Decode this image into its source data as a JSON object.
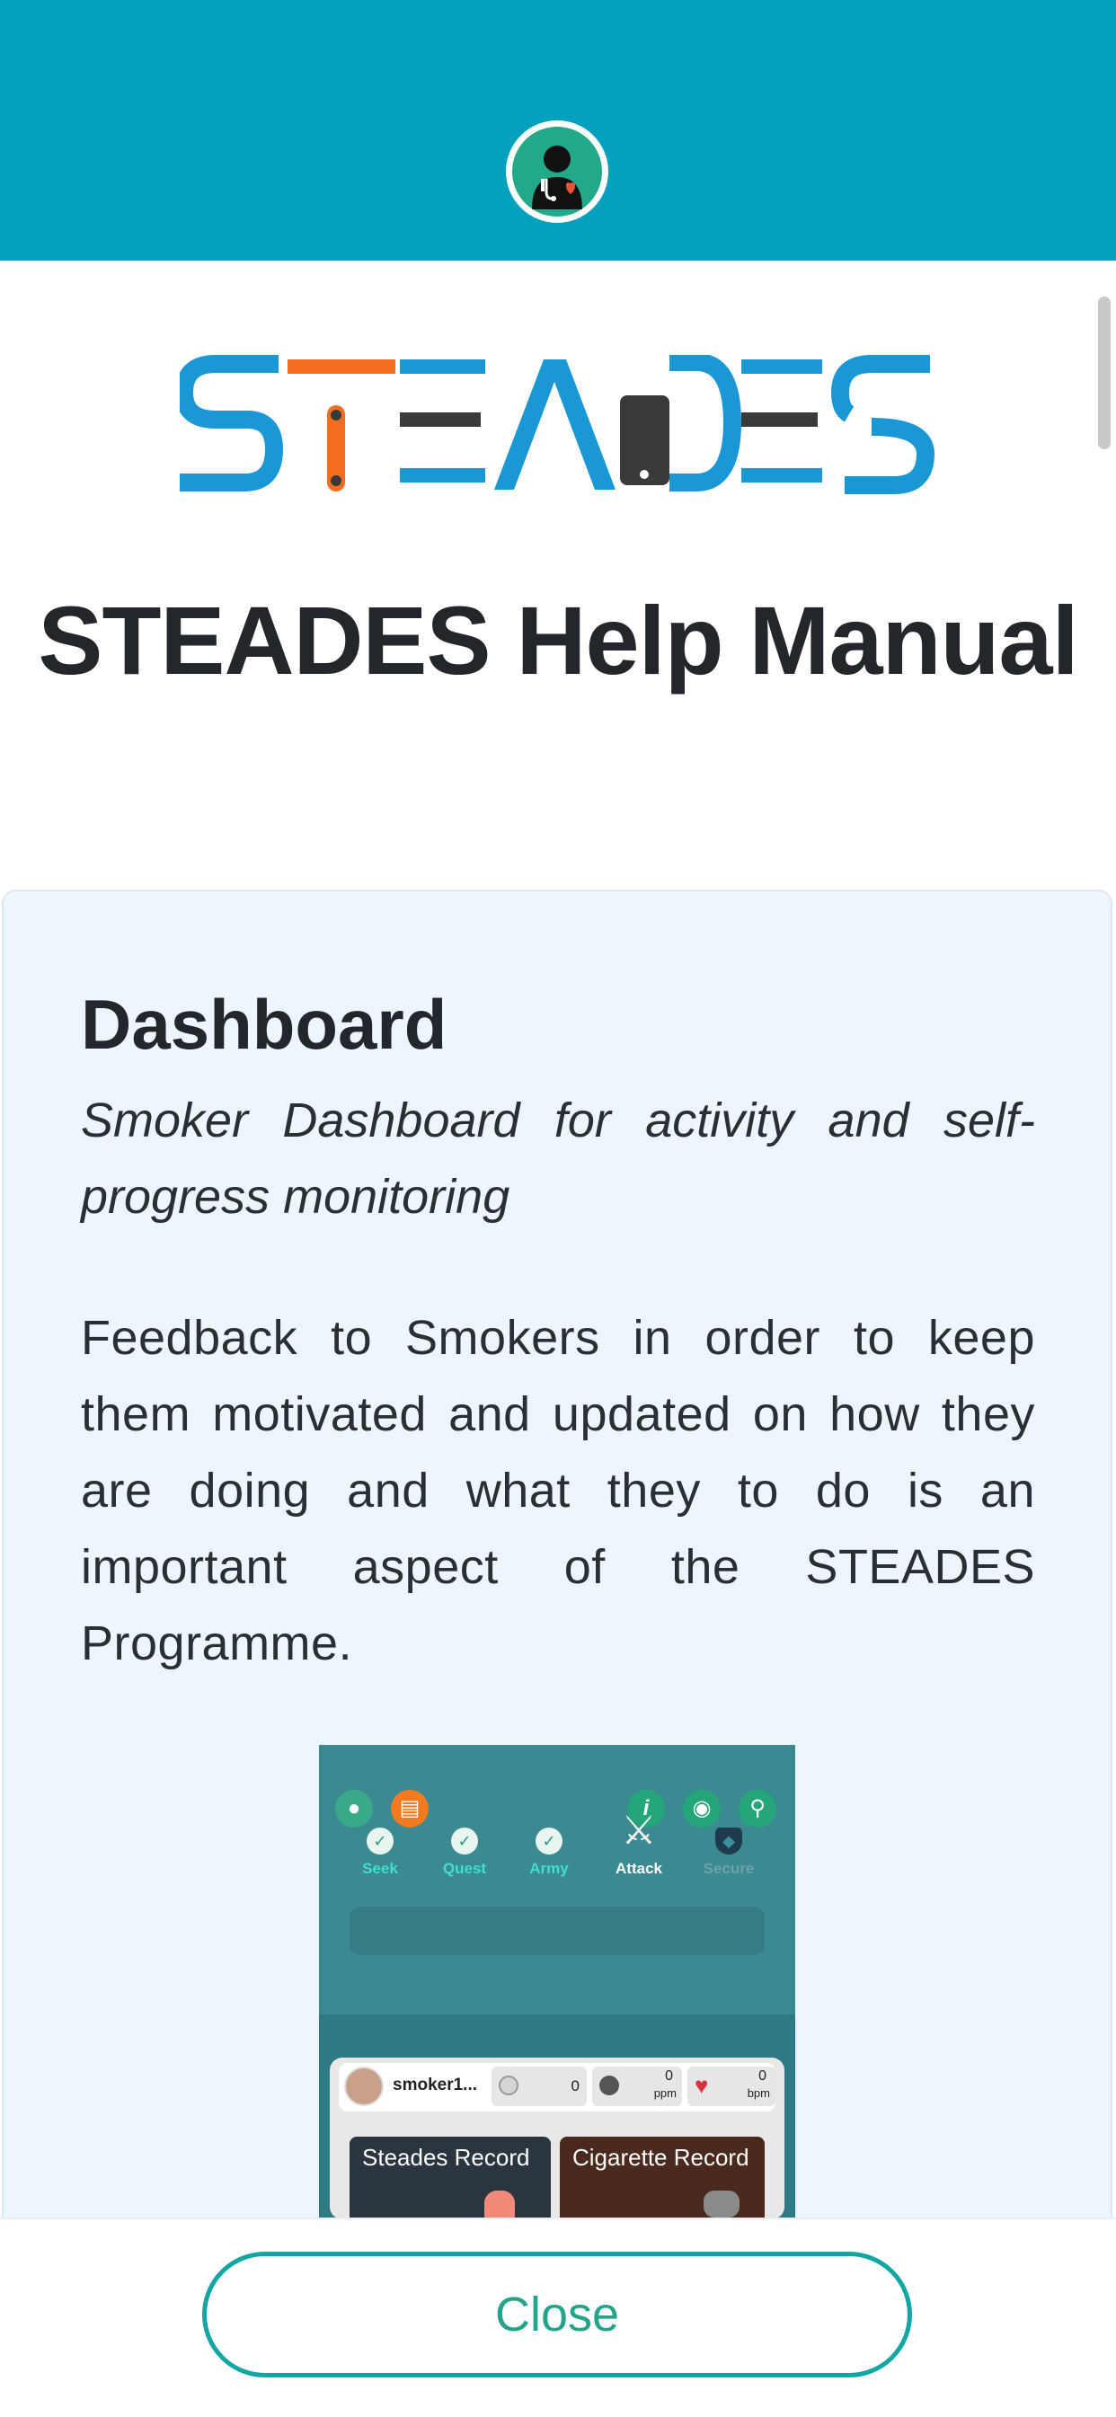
{
  "header": {
    "avatar_icon": "doctor-avatar-icon",
    "bar_color": "#04a1be"
  },
  "logo": {
    "text": "STEADES",
    "colors": {
      "blue": "#1a97d5",
      "orange": "#f36d21",
      "dark": "#3a3a3a"
    }
  },
  "page": {
    "title": "STEADES Help Manual"
  },
  "section": {
    "heading": "Dashboard",
    "subtitle": "Smoker Dashboard for activity and self-progress monitoring",
    "body": "Feedback to Smokers in order to keep them motivated and updated on how they are doing and what they to do is an important aspect of the STEADES Programme."
  },
  "screenshot": {
    "nav": [
      {
        "label": "Seek",
        "icon": "check-icon",
        "color": "#3ee0c8"
      },
      {
        "label": "Quest",
        "icon": "check-icon",
        "color": "#3ee0c8"
      },
      {
        "label": "Army",
        "icon": "check-icon",
        "color": "#3ee0c8"
      },
      {
        "label": "Attack",
        "icon": "swords-icon",
        "color": "#ffffff"
      },
      {
        "label": "Secure",
        "icon": "shield-icon",
        "color": "#6aa3a8"
      }
    ],
    "status": {
      "username": "smoker1...",
      "count": "0",
      "co_value": "0",
      "co_unit": "ppm",
      "heart_value": "0",
      "heart_unit": "bpm"
    },
    "records": {
      "steades": "Steades Record",
      "cigarette": "Cigarette Record"
    }
  },
  "footer": {
    "close_label": "Close"
  }
}
